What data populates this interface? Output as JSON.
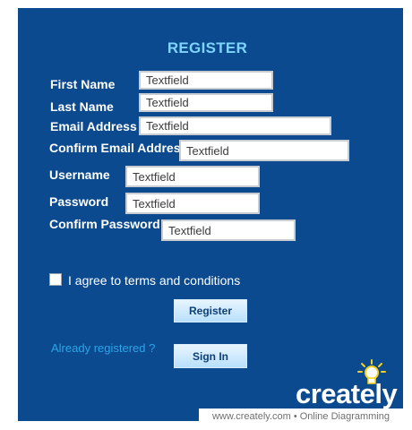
{
  "form": {
    "title": "REGISTER",
    "fields": [
      {
        "label": "First Name",
        "value": "Textfield"
      },
      {
        "label": "Last Name",
        "value": "Textfield"
      },
      {
        "label": "Email Address",
        "value": "Textfield"
      },
      {
        "label": "Confirm Email Address",
        "value": "Textfield"
      },
      {
        "label": "Username",
        "value": "Textfield"
      },
      {
        "label": "Password",
        "value": "Textfield"
      },
      {
        "label": "Confirm Password",
        "value": "Textfield"
      }
    ],
    "terms_label": "I agree to terms and conditions",
    "terms_checked": false,
    "register_label": "Register",
    "already_registered": "Already registered ?",
    "signin_label": "Sign In"
  },
  "brand": {
    "logo_text": "creately",
    "footer": "www.creately.com • Online Diagramming"
  },
  "colors": {
    "panel": "#0b4a8e",
    "title": "#7fd4ff",
    "link": "#2aa5e8"
  }
}
